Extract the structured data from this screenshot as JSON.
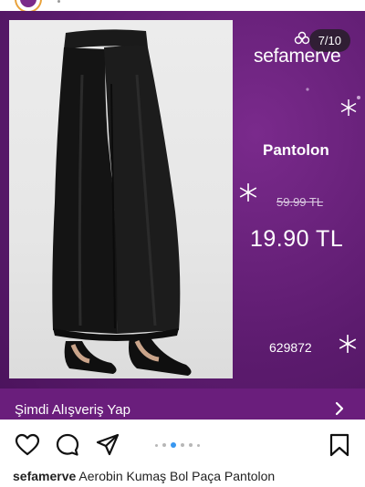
{
  "slide_counter": "7/10",
  "brand_name": "sefamerve",
  "product": {
    "name": "Pantolon",
    "old_price": "59.99 TL",
    "new_price": "19.90 TL",
    "code": "629872"
  },
  "shop_cta": "Şimdi Alışveriş Yap",
  "carousel": {
    "total_dots": 6,
    "active_index": 2
  },
  "caption": {
    "username": "sefamerve",
    "text": "Aerobin Kumaş Bol Paça Pantolon"
  },
  "colors": {
    "media_bg": "#5c1b6e",
    "cta_bar": "#6a1e7c",
    "carousel_active": "#3897f0"
  },
  "icons": [
    "heart-icon",
    "comment-icon",
    "share-icon",
    "bookmark-icon",
    "chevron-right-icon",
    "snowflake-icon"
  ]
}
